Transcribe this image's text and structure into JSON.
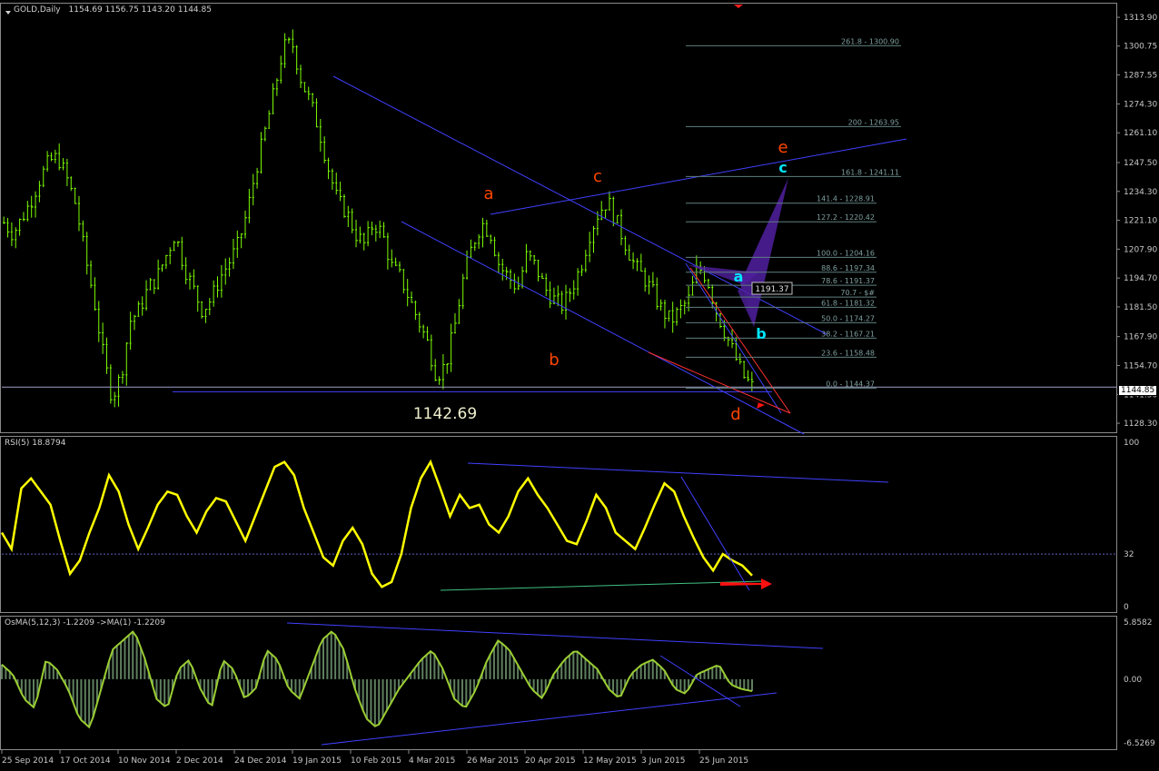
{
  "main": {
    "symbol_label": "GOLD,Daily",
    "ohlc": "1154.69 1156.75 1143.20 1144.85",
    "current_price": "1144.85",
    "low_note": "1142.69",
    "cursor_price_box": "1191.37",
    "y_ticks": [
      "1313.90",
      "1300.75",
      "1287.55",
      "1274.30",
      "1261.10",
      "1247.50",
      "1234.30",
      "1221.10",
      "1207.90",
      "1194.70",
      "1181.50",
      "1167.90",
      "1154.70",
      "1141.50",
      "1128.30"
    ],
    "wave_labels_red": [
      "a",
      "b",
      "c",
      "d",
      "e"
    ],
    "wave_labels_cyan": [
      "a",
      "b",
      "c"
    ],
    "fibo_levels": [
      "261.8 - 1300.90",
      "200 - 1263.95",
      "161.8 - 1241.11",
      "141.4 - 1228.91",
      "127.2 - 1220.42",
      "100.0 - 1204.16",
      "88.6 - 1197.34",
      "78.6 - 1191.37",
      "70.7 - $#",
      "61.8 - 1181.32",
      "50.0 - 1174.27",
      "38.2 - 1167.21",
      "23.6 - 1158.48",
      "0.0 - 1144.37"
    ]
  },
  "rsi": {
    "label": "RSI(5) 18.8794",
    "y_ticks": [
      "100",
      "32",
      "0"
    ]
  },
  "osma": {
    "label": "OsMA(5,12,3) -1.2209 ->MA(1) -1.2209",
    "y_ticks": [
      "5.8582",
      "0.00",
      "-6.5269"
    ]
  },
  "x_ticks": [
    "25 Sep 2014",
    "17 Oct 2014",
    "10 Nov 2014",
    "2 Dec 2014",
    "24 Dec 2014",
    "19 Jan 2015",
    "10 Feb 2015",
    "4 Mar 2015",
    "26 Mar 2015",
    "20 Apr 2015",
    "12 May 2015",
    "3 Jun 2015",
    "25 Jun 2015"
  ],
  "colors": {
    "background": "#000000",
    "candles": "#7CFC00",
    "trendlines": "#4040ff",
    "rsi_line": "#ffff00",
    "osma_line": "#9acd32",
    "osma_hist": "#5f7f5f",
    "wave_red": "#ff4500",
    "wave_cyan": "#00e5ff",
    "fibo": "#5f7f7f",
    "pattern_fill": "#5020a0"
  },
  "chart_data": [
    {
      "type": "candlestick",
      "title": "GOLD,Daily",
      "ylim": [
        1125,
        1316
      ],
      "x": [
        "25 Sep 2014",
        "17 Oct 2014",
        "10 Nov 2014",
        "2 Dec 2014",
        "24 Dec 2014",
        "19 Jan 2015",
        "10 Feb 2015",
        "4 Mar 2015",
        "26 Mar 2015",
        "20 Apr 2015",
        "12 May 2015",
        "3 Jun 2015",
        "25 Jun 2015"
      ],
      "close_path": [
        1220,
        1215,
        1222,
        1230,
        1240,
        1248,
        1250,
        1240,
        1228,
        1205,
        1185,
        1160,
        1140,
        1150,
        1175,
        1180,
        1190,
        1195,
        1205,
        1215,
        1200,
        1190,
        1180,
        1185,
        1195,
        1202,
        1210,
        1225,
        1245,
        1262,
        1280,
        1300,
        1302,
        1285,
        1275,
        1262,
        1245,
        1230,
        1225,
        1215,
        1210,
        1220,
        1215,
        1200,
        1195,
        1185,
        1175,
        1165,
        1150,
        1155,
        1172,
        1195,
        1210,
        1220,
        1215,
        1200,
        1195,
        1190,
        1205,
        1200,
        1190,
        1185,
        1182,
        1190,
        1200,
        1215,
        1225,
        1230,
        1220,
        1210,
        1200,
        1195,
        1188,
        1180,
        1175,
        1180,
        1185,
        1200,
        1195,
        1180,
        1170,
        1160,
        1150,
        1145
      ],
      "levels": {
        "support_low": 1142.69,
        "last": 1144.85
      }
    },
    {
      "type": "line",
      "title": "RSI(5) 18.8794",
      "ylim": [
        0,
        100
      ],
      "reference_level": 32,
      "values": [
        45,
        35,
        72,
        78,
        70,
        62,
        40,
        20,
        28,
        45,
        60,
        80,
        70,
        50,
        35,
        48,
        62,
        70,
        68,
        55,
        45,
        58,
        66,
        64,
        52,
        40,
        55,
        70,
        85,
        88,
        80,
        60,
        45,
        30,
        25,
        40,
        48,
        38,
        20,
        12,
        15,
        32,
        60,
        78,
        88,
        72,
        55,
        68,
        60,
        62,
        50,
        45,
        55,
        70,
        78,
        68,
        60,
        50,
        40,
        38,
        52,
        68,
        60,
        45,
        40,
        35,
        48,
        62,
        75,
        70,
        55,
        42,
        30,
        22,
        32,
        28,
        25,
        18.9
      ]
    },
    {
      "type": "bar",
      "title": "OsMA(5,12,3) -1.2209 ->MA(1) -1.2209",
      "ylim": [
        -6.5269,
        5.8582
      ],
      "values": [
        1.5,
        0.5,
        -2,
        -3,
        2,
        1,
        -1,
        -4,
        -5,
        -1,
        3,
        4,
        5,
        2,
        -2,
        -3,
        1,
        2,
        -1,
        -3,
        2,
        1,
        -2,
        -1,
        3,
        2,
        -1,
        -2,
        1,
        4,
        5,
        3,
        -1,
        -4,
        -5,
        -3,
        -1,
        0.5,
        2,
        3,
        1,
        -2,
        -3,
        -1,
        2,
        4,
        3,
        1,
        -1,
        -2,
        0.5,
        2,
        3,
        2,
        1,
        -1,
        -2,
        0.5,
        1.5,
        2,
        1,
        -1,
        -1.5,
        0.5,
        1,
        1.5,
        -0.5,
        -1,
        -1.2209
      ]
    }
  ]
}
